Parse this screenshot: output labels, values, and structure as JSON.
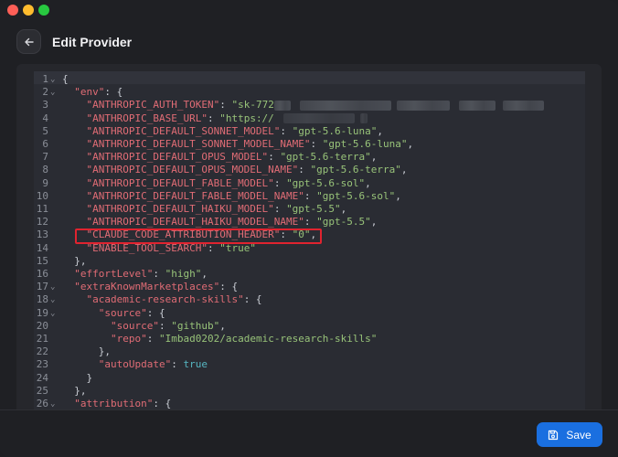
{
  "header": {
    "title": "Edit Provider"
  },
  "icons": {
    "back": "arrow-left-icon",
    "save": "floppy-disk-icon"
  },
  "footer": {
    "save_label": "Save"
  },
  "colors": {
    "accent": "#1a6fe0",
    "highlight": "#e0232f",
    "key": "#e06c75",
    "string": "#98c379"
  },
  "editor": {
    "lines": [
      {
        "n": "1",
        "fold": true,
        "parts": [
          [
            "p",
            "{"
          ]
        ]
      },
      {
        "n": "2",
        "fold": true,
        "parts": [
          [
            "p",
            "  "
          ],
          [
            "k",
            "\"env\""
          ],
          [
            "p",
            ": {"
          ]
        ]
      },
      {
        "n": "3",
        "fold": false,
        "parts": [
          [
            "p",
            "    "
          ],
          [
            "k",
            "\"ANTHROPIC_AUTH_TOKEN\""
          ],
          [
            "p",
            ": "
          ],
          [
            "s",
            "\"sk-772"
          ]
        ]
      },
      {
        "n": "4",
        "fold": false,
        "parts": [
          [
            "p",
            "    "
          ],
          [
            "k",
            "\"ANTHROPIC_BASE_URL\""
          ],
          [
            "p",
            ": "
          ],
          [
            "s",
            "\"https://"
          ]
        ]
      },
      {
        "n": "5",
        "fold": false,
        "parts": [
          [
            "p",
            "    "
          ],
          [
            "k",
            "\"ANTHROPIC_DEFAULT_SONNET_MODEL\""
          ],
          [
            "p",
            ": "
          ],
          [
            "s",
            "\"gpt-5.6-luna\""
          ],
          [
            "p",
            ","
          ]
        ]
      },
      {
        "n": "6",
        "fold": false,
        "parts": [
          [
            "p",
            "    "
          ],
          [
            "k",
            "\"ANTHROPIC_DEFAULT_SONNET_MODEL_NAME\""
          ],
          [
            "p",
            ": "
          ],
          [
            "s",
            "\"gpt-5.6-luna\""
          ],
          [
            "p",
            ","
          ]
        ]
      },
      {
        "n": "7",
        "fold": false,
        "parts": [
          [
            "p",
            "    "
          ],
          [
            "k",
            "\"ANTHROPIC_DEFAULT_OPUS_MODEL\""
          ],
          [
            "p",
            ": "
          ],
          [
            "s",
            "\"gpt-5.6-terra\""
          ],
          [
            "p",
            ","
          ]
        ]
      },
      {
        "n": "8",
        "fold": false,
        "parts": [
          [
            "p",
            "    "
          ],
          [
            "k",
            "\"ANTHROPIC_DEFAULT_OPUS_MODEL_NAME\""
          ],
          [
            "p",
            ": "
          ],
          [
            "s",
            "\"gpt-5.6-terra\""
          ],
          [
            "p",
            ","
          ]
        ]
      },
      {
        "n": "9",
        "fold": false,
        "parts": [
          [
            "p",
            "    "
          ],
          [
            "k",
            "\"ANTHROPIC_DEFAULT_FABLE_MODEL\""
          ],
          [
            "p",
            ": "
          ],
          [
            "s",
            "\"gpt-5.6-sol\""
          ],
          [
            "p",
            ","
          ]
        ]
      },
      {
        "n": "10",
        "fold": false,
        "parts": [
          [
            "p",
            "    "
          ],
          [
            "k",
            "\"ANTHROPIC_DEFAULT_FABLE_MODEL_NAME\""
          ],
          [
            "p",
            ": "
          ],
          [
            "s",
            "\"gpt-5.6-sol\""
          ],
          [
            "p",
            ","
          ]
        ]
      },
      {
        "n": "11",
        "fold": false,
        "parts": [
          [
            "p",
            "    "
          ],
          [
            "k",
            "\"ANTHROPIC_DEFAULT_HAIKU_MODEL\""
          ],
          [
            "p",
            ": "
          ],
          [
            "s",
            "\"gpt-5.5\""
          ],
          [
            "p",
            ","
          ]
        ]
      },
      {
        "n": "12",
        "fold": false,
        "parts": [
          [
            "p",
            "    "
          ],
          [
            "k",
            "\"ANTHROPIC_DEFAULT_HAIKU_MODEL_NAME\""
          ],
          [
            "p",
            ": "
          ],
          [
            "s",
            "\"gpt-5.5\""
          ],
          [
            "p",
            ","
          ]
        ]
      },
      {
        "n": "13",
        "fold": false,
        "parts": [
          [
            "p",
            "    "
          ],
          [
            "k",
            "\"CLAUDE_CODE_ATTRIBUTION_HEADER\""
          ],
          [
            "p",
            ": "
          ],
          [
            "s",
            "\"0\""
          ],
          [
            "p",
            ","
          ]
        ]
      },
      {
        "n": "14",
        "fold": false,
        "parts": [
          [
            "p",
            "    "
          ],
          [
            "k",
            "\"ENABLE_TOOL_SEARCH\""
          ],
          [
            "p",
            ": "
          ],
          [
            "s",
            "\"true\""
          ]
        ]
      },
      {
        "n": "15",
        "fold": false,
        "parts": [
          [
            "p",
            "  },"
          ]
        ]
      },
      {
        "n": "16",
        "fold": false,
        "parts": [
          [
            "p",
            "  "
          ],
          [
            "k",
            "\"effortLevel\""
          ],
          [
            "p",
            ": "
          ],
          [
            "s",
            "\"high\""
          ],
          [
            "p",
            ","
          ]
        ]
      },
      {
        "n": "17",
        "fold": true,
        "parts": [
          [
            "p",
            "  "
          ],
          [
            "k",
            "\"extraKnownMarketplaces\""
          ],
          [
            "p",
            ": {"
          ]
        ]
      },
      {
        "n": "18",
        "fold": true,
        "parts": [
          [
            "p",
            "    "
          ],
          [
            "k",
            "\"academic-research-skills\""
          ],
          [
            "p",
            ": {"
          ]
        ]
      },
      {
        "n": "19",
        "fold": true,
        "parts": [
          [
            "p",
            "      "
          ],
          [
            "k",
            "\"source\""
          ],
          [
            "p",
            ": {"
          ]
        ]
      },
      {
        "n": "20",
        "fold": false,
        "parts": [
          [
            "p",
            "        "
          ],
          [
            "k",
            "\"source\""
          ],
          [
            "p",
            ": "
          ],
          [
            "s",
            "\"github\""
          ],
          [
            "p",
            ","
          ]
        ]
      },
      {
        "n": "21",
        "fold": false,
        "parts": [
          [
            "p",
            "        "
          ],
          [
            "k",
            "\"repo\""
          ],
          [
            "p",
            ": "
          ],
          [
            "s",
            "\"Imbad0202/academic-research-skills\""
          ]
        ]
      },
      {
        "n": "22",
        "fold": false,
        "parts": [
          [
            "p",
            "      },"
          ]
        ]
      },
      {
        "n": "23",
        "fold": false,
        "parts": [
          [
            "p",
            "      "
          ],
          [
            "k",
            "\"autoUpdate\""
          ],
          [
            "p",
            ": "
          ],
          [
            "b",
            "true"
          ]
        ]
      },
      {
        "n": "24",
        "fold": false,
        "parts": [
          [
            "p",
            "    }"
          ]
        ]
      },
      {
        "n": "25",
        "fold": false,
        "parts": [
          [
            "p",
            "  },"
          ]
        ]
      },
      {
        "n": "26",
        "fold": true,
        "parts": [
          [
            "p",
            "  "
          ],
          [
            "k",
            "\"attribution\""
          ],
          [
            "p",
            ": {"
          ]
        ]
      }
    ]
  }
}
